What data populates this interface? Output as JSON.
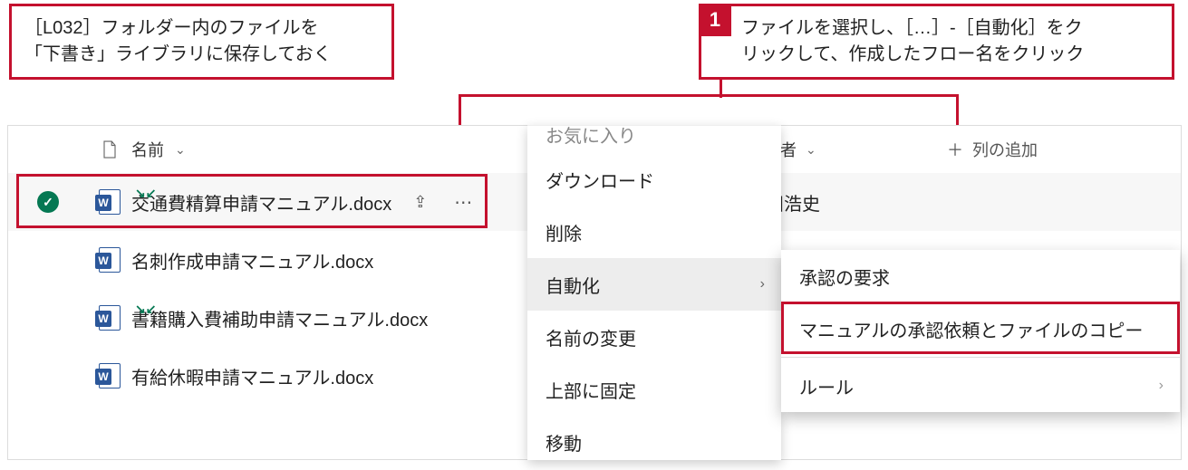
{
  "annotations": {
    "left_line1": "［L032］フォルダー内のファイルを",
    "left_line2": "「下書き」ライブラリに保存しておく",
    "step_number": "1",
    "right_line1": "ファイルを選択し、［…］-［自動化］をク",
    "right_line2": "リックして、作成したフロー名をクリック"
  },
  "list": {
    "header_name": "名前",
    "header_updater": "更新者",
    "header_add_column": "列の追加"
  },
  "rows": [
    {
      "name": "交通費精算申請マニュアル.docx",
      "updater": "太田浩史",
      "is_new": true,
      "selected": true
    },
    {
      "name": "名刺作成申請マニュアル.docx",
      "updater": "",
      "is_new": false,
      "selected": false
    },
    {
      "name": "書籍購入費補助申請マニュアル.docx",
      "updater": "",
      "is_new": true,
      "selected": false
    },
    {
      "name": "有給休暇申請マニュアル.docx",
      "updater": "",
      "is_new": false,
      "selected": false
    }
  ],
  "context_menu": {
    "item_bookmarks_cut": "お気に入り",
    "item_download": "ダウンロード",
    "item_delete": "削除",
    "item_automate": "自動化",
    "item_rename": "名前の変更",
    "item_pin": "上部に固定",
    "item_move": "移動"
  },
  "automate_submenu": {
    "item_approve": "承認の要求",
    "item_flow": "マニュアルの承認依頼とファイルのコピー",
    "item_rules": "ルール"
  }
}
